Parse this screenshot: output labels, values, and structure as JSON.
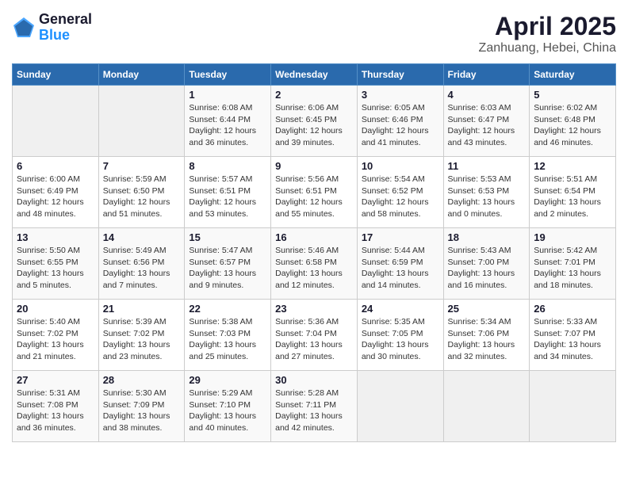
{
  "header": {
    "logo_general": "General",
    "logo_blue": "Blue",
    "month_year": "April 2025",
    "location": "Zanhuang, Hebei, China"
  },
  "weekdays": [
    "Sunday",
    "Monday",
    "Tuesday",
    "Wednesday",
    "Thursday",
    "Friday",
    "Saturday"
  ],
  "weeks": [
    [
      {
        "day": "",
        "sunrise": "",
        "sunset": "",
        "daylight": ""
      },
      {
        "day": "",
        "sunrise": "",
        "sunset": "",
        "daylight": ""
      },
      {
        "day": "1",
        "sunrise": "Sunrise: 6:08 AM",
        "sunset": "Sunset: 6:44 PM",
        "daylight": "Daylight: 12 hours and 36 minutes."
      },
      {
        "day": "2",
        "sunrise": "Sunrise: 6:06 AM",
        "sunset": "Sunset: 6:45 PM",
        "daylight": "Daylight: 12 hours and 39 minutes."
      },
      {
        "day": "3",
        "sunrise": "Sunrise: 6:05 AM",
        "sunset": "Sunset: 6:46 PM",
        "daylight": "Daylight: 12 hours and 41 minutes."
      },
      {
        "day": "4",
        "sunrise": "Sunrise: 6:03 AM",
        "sunset": "Sunset: 6:47 PM",
        "daylight": "Daylight: 12 hours and 43 minutes."
      },
      {
        "day": "5",
        "sunrise": "Sunrise: 6:02 AM",
        "sunset": "Sunset: 6:48 PM",
        "daylight": "Daylight: 12 hours and 46 minutes."
      }
    ],
    [
      {
        "day": "6",
        "sunrise": "Sunrise: 6:00 AM",
        "sunset": "Sunset: 6:49 PM",
        "daylight": "Daylight: 12 hours and 48 minutes."
      },
      {
        "day": "7",
        "sunrise": "Sunrise: 5:59 AM",
        "sunset": "Sunset: 6:50 PM",
        "daylight": "Daylight: 12 hours and 51 minutes."
      },
      {
        "day": "8",
        "sunrise": "Sunrise: 5:57 AM",
        "sunset": "Sunset: 6:51 PM",
        "daylight": "Daylight: 12 hours and 53 minutes."
      },
      {
        "day": "9",
        "sunrise": "Sunrise: 5:56 AM",
        "sunset": "Sunset: 6:51 PM",
        "daylight": "Daylight: 12 hours and 55 minutes."
      },
      {
        "day": "10",
        "sunrise": "Sunrise: 5:54 AM",
        "sunset": "Sunset: 6:52 PM",
        "daylight": "Daylight: 12 hours and 58 minutes."
      },
      {
        "day": "11",
        "sunrise": "Sunrise: 5:53 AM",
        "sunset": "Sunset: 6:53 PM",
        "daylight": "Daylight: 13 hours and 0 minutes."
      },
      {
        "day": "12",
        "sunrise": "Sunrise: 5:51 AM",
        "sunset": "Sunset: 6:54 PM",
        "daylight": "Daylight: 13 hours and 2 minutes."
      }
    ],
    [
      {
        "day": "13",
        "sunrise": "Sunrise: 5:50 AM",
        "sunset": "Sunset: 6:55 PM",
        "daylight": "Daylight: 13 hours and 5 minutes."
      },
      {
        "day": "14",
        "sunrise": "Sunrise: 5:49 AM",
        "sunset": "Sunset: 6:56 PM",
        "daylight": "Daylight: 13 hours and 7 minutes."
      },
      {
        "day": "15",
        "sunrise": "Sunrise: 5:47 AM",
        "sunset": "Sunset: 6:57 PM",
        "daylight": "Daylight: 13 hours and 9 minutes."
      },
      {
        "day": "16",
        "sunrise": "Sunrise: 5:46 AM",
        "sunset": "Sunset: 6:58 PM",
        "daylight": "Daylight: 13 hours and 12 minutes."
      },
      {
        "day": "17",
        "sunrise": "Sunrise: 5:44 AM",
        "sunset": "Sunset: 6:59 PM",
        "daylight": "Daylight: 13 hours and 14 minutes."
      },
      {
        "day": "18",
        "sunrise": "Sunrise: 5:43 AM",
        "sunset": "Sunset: 7:00 PM",
        "daylight": "Daylight: 13 hours and 16 minutes."
      },
      {
        "day": "19",
        "sunrise": "Sunrise: 5:42 AM",
        "sunset": "Sunset: 7:01 PM",
        "daylight": "Daylight: 13 hours and 18 minutes."
      }
    ],
    [
      {
        "day": "20",
        "sunrise": "Sunrise: 5:40 AM",
        "sunset": "Sunset: 7:02 PM",
        "daylight": "Daylight: 13 hours and 21 minutes."
      },
      {
        "day": "21",
        "sunrise": "Sunrise: 5:39 AM",
        "sunset": "Sunset: 7:02 PM",
        "daylight": "Daylight: 13 hours and 23 minutes."
      },
      {
        "day": "22",
        "sunrise": "Sunrise: 5:38 AM",
        "sunset": "Sunset: 7:03 PM",
        "daylight": "Daylight: 13 hours and 25 minutes."
      },
      {
        "day": "23",
        "sunrise": "Sunrise: 5:36 AM",
        "sunset": "Sunset: 7:04 PM",
        "daylight": "Daylight: 13 hours and 27 minutes."
      },
      {
        "day": "24",
        "sunrise": "Sunrise: 5:35 AM",
        "sunset": "Sunset: 7:05 PM",
        "daylight": "Daylight: 13 hours and 30 minutes."
      },
      {
        "day": "25",
        "sunrise": "Sunrise: 5:34 AM",
        "sunset": "Sunset: 7:06 PM",
        "daylight": "Daylight: 13 hours and 32 minutes."
      },
      {
        "day": "26",
        "sunrise": "Sunrise: 5:33 AM",
        "sunset": "Sunset: 7:07 PM",
        "daylight": "Daylight: 13 hours and 34 minutes."
      }
    ],
    [
      {
        "day": "27",
        "sunrise": "Sunrise: 5:31 AM",
        "sunset": "Sunset: 7:08 PM",
        "daylight": "Daylight: 13 hours and 36 minutes."
      },
      {
        "day": "28",
        "sunrise": "Sunrise: 5:30 AM",
        "sunset": "Sunset: 7:09 PM",
        "daylight": "Daylight: 13 hours and 38 minutes."
      },
      {
        "day": "29",
        "sunrise": "Sunrise: 5:29 AM",
        "sunset": "Sunset: 7:10 PM",
        "daylight": "Daylight: 13 hours and 40 minutes."
      },
      {
        "day": "30",
        "sunrise": "Sunrise: 5:28 AM",
        "sunset": "Sunset: 7:11 PM",
        "daylight": "Daylight: 13 hours and 42 minutes."
      },
      {
        "day": "",
        "sunrise": "",
        "sunset": "",
        "daylight": ""
      },
      {
        "day": "",
        "sunrise": "",
        "sunset": "",
        "daylight": ""
      },
      {
        "day": "",
        "sunrise": "",
        "sunset": "",
        "daylight": ""
      }
    ]
  ]
}
